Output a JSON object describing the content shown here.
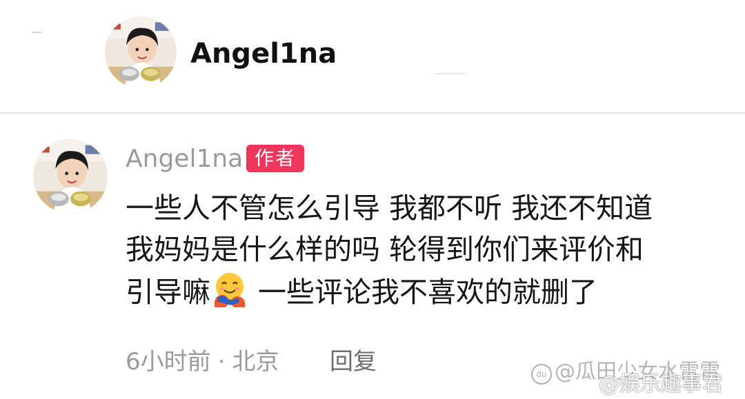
{
  "header": {
    "username": "Angel1na"
  },
  "comment": {
    "username": "Angel1na",
    "badge": "作者",
    "lines": [
      "一些人不管怎么引导 我都不听 我还不知道",
      "我妈妈是什么样的吗 轮得到你们来评价和",
      "引导嘛",
      " 一些评论我不喜欢的就删了"
    ],
    "emoji": "hugging-face-icon",
    "time": "6小时前",
    "separator": "·",
    "location": "北京",
    "reply_label": "回复"
  },
  "watermarks": {
    "line1": "@瓜田少女水雷雷",
    "line2": "@娱乐趣事君",
    "logo_text": "du"
  },
  "colors": {
    "badge_bg": "#f1365c",
    "username_gray": "#9a9a9a",
    "text": "#161616"
  }
}
